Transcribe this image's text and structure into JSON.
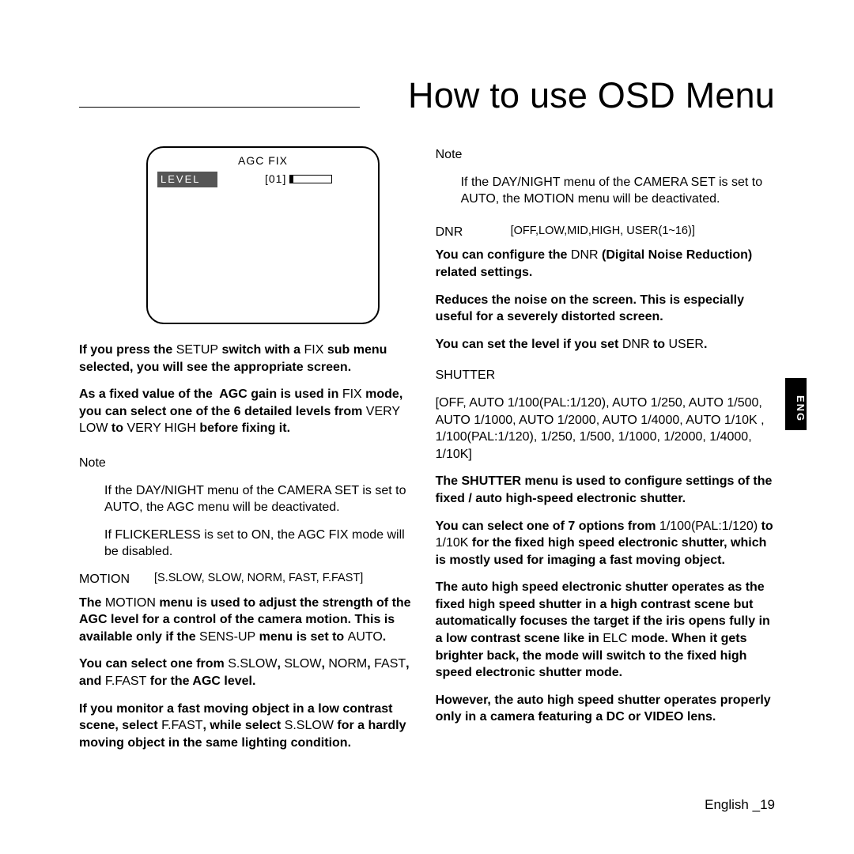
{
  "title": "How to use OSD Menu",
  "osd": {
    "title": "AGC FIX",
    "row_label": "LEVEL",
    "row_value": "[01]"
  },
  "left": {
    "p1": "If you press the SETUP switch with a FIX sub menu selected, you will see the appropriate screen.",
    "p2": "As a fixed value of the  AGC gain is used in FIX mode, you can select one of the 6 detailed levels from VERY LOW to VERY HIGH before fixing it.",
    "note_label": "Note",
    "note1": "If the DAY/NIGHT menu of the CAMERA SET is set to AUTO, the AGC menu will be deactivated.",
    "note2": "If FLICKERLESS is set to ON, the AGC FIX mode will be disabled.",
    "motion_label": "MOTION",
    "motion_opts": "[S.SLOW, SLOW, NORM, FAST, F.FAST]",
    "p3": "The MOTION menu is used to adjust the strength of the AGC level for a control of the camera motion. This is available only if the SENS-UP menu is set to AUTO.",
    "p4": "You can select one from S.SLOW, SLOW, NORM, FAST, and F.FAST for the AGC level.",
    "p5": "If you monitor a fast moving object in a low contrast scene, select F.FAST, while select S.SLOW for a hardly moving object in the same lighting condition."
  },
  "right": {
    "note_label": "Note",
    "note1": "If the DAY/NIGHT menu of the CAMERA SET is set to AUTO, the MOTION menu will be deactivated.",
    "dnr_label": "DNR",
    "dnr_opts": "[OFF,LOW,MID,HIGH, USER(1~16)]",
    "p1": "You can configure the DNR (Digital Noise Reduction) related settings.",
    "p2": "Reduces the noise on the screen. This is especially useful for a severely distorted screen.",
    "p3": "You can set the level if you set DNR to USER.",
    "shutter_label": "SHUTTER",
    "shutter_opts": "[OFF, AUTO 1/100(PAL:1/120), AUTO 1/250, AUTO 1/500, AUTO 1/1000, AUTO 1/2000, AUTO 1/4000, AUTO 1/10K , 1/100(PAL:1/120), 1/250, 1/500, 1/1000, 1/2000, 1/4000, 1/10K]",
    "p4": "The SHUTTER menu is used to configure settings of the fixed / auto high-speed electronic shutter.",
    "p5": "You can select one of 7 options from 1/100(PAL:1/120) to 1/10K for the fixed high speed electronic shutter, which is mostly used for imaging a fast moving object.",
    "p6": "The auto high speed electronic shutter operates as the fixed high speed shutter in a high contrast scene but automatically focuses the target if the iris opens fully in a low contrast scene like in ELC mode. When it gets brighter back, the mode will switch to the fixed high speed electronic shutter mode.",
    "p7": "However, the auto high speed shutter operates properly only in a camera featuring a DC or VIDEO lens."
  },
  "sidetab": "ENG",
  "footer_lang": "English",
  "footer_page": "_19"
}
